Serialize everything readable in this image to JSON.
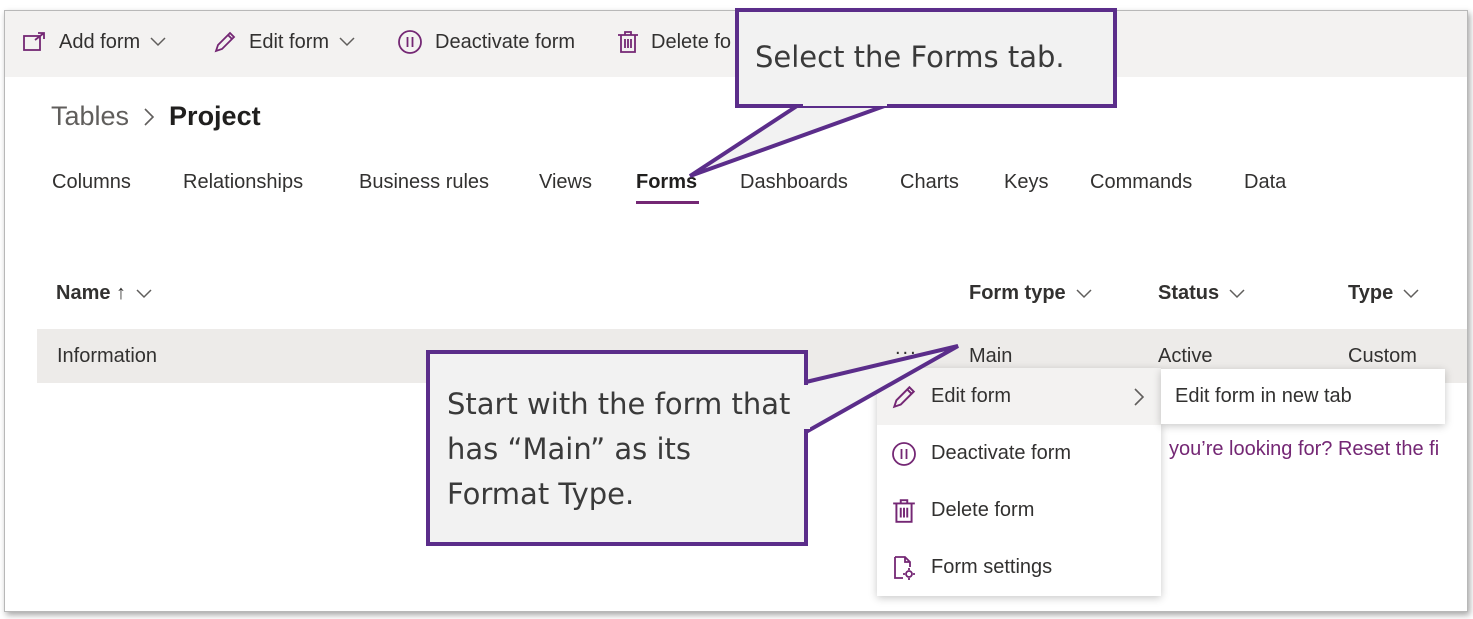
{
  "toolbar": {
    "add_form": "Add form",
    "edit_form": "Edit form",
    "deactivate_form": "Deactivate form",
    "delete_form_partial": "Delete fo"
  },
  "breadcrumb": {
    "parent": "Tables",
    "current": "Project"
  },
  "tabs": [
    {
      "label": "Columns"
    },
    {
      "label": "Relationships"
    },
    {
      "label": "Business rules"
    },
    {
      "label": "Views"
    },
    {
      "label": "Forms",
      "active": true
    },
    {
      "label": "Dashboards"
    },
    {
      "label": "Charts"
    },
    {
      "label": "Keys"
    },
    {
      "label": "Commands"
    },
    {
      "label": "Data"
    }
  ],
  "table": {
    "columns": {
      "name": "Name ↑",
      "form_type": "Form type",
      "status": "Status",
      "type": "Type"
    },
    "rows": [
      {
        "name": "Information",
        "more": "...",
        "form_type": "Main",
        "status": "Active",
        "type": "Custom"
      }
    ]
  },
  "context_menu": {
    "items": [
      {
        "label": "Edit form",
        "icon": "pencil-icon"
      },
      {
        "label": "Deactivate form",
        "icon": "pause-circle-icon"
      },
      {
        "label": "Delete form",
        "icon": "trash-icon"
      },
      {
        "label": "Form settings",
        "icon": "settings-document-icon"
      }
    ],
    "submenu": {
      "label": "Edit form in new tab"
    }
  },
  "reset_text": "you’re looking for? Reset the fi",
  "callouts": {
    "top": "Select the Forms tab.",
    "bottom_lines": [
      "Start with the form that",
      "has “Main” as its",
      "Format Type."
    ]
  },
  "colors": {
    "accent": "#742774",
    "callout_border": "#5b2d8a",
    "callout_fill": "#f2f2f2",
    "toolbar_bg": "#f3f2f1"
  }
}
